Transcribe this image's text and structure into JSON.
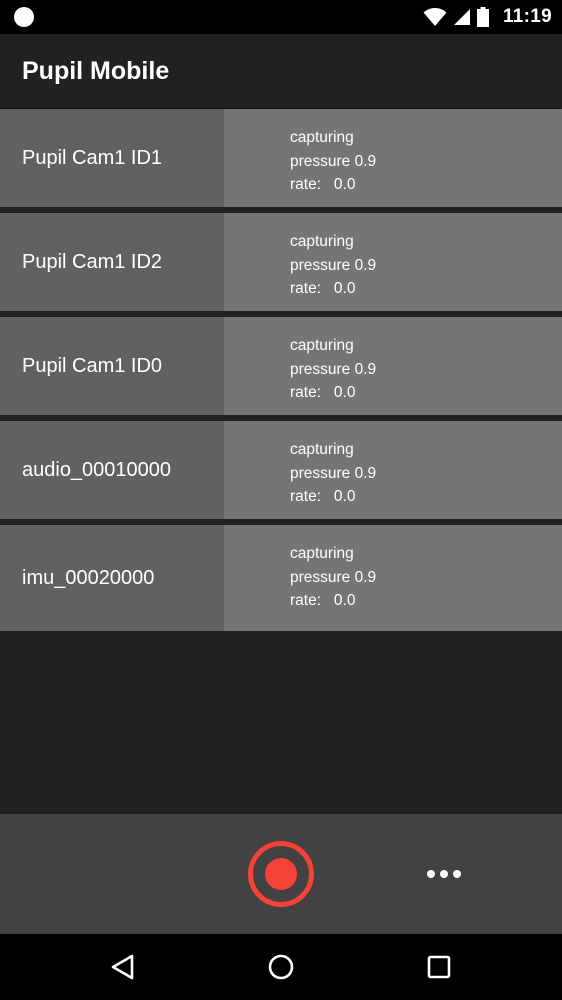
{
  "status_bar": {
    "time": "11:19",
    "icons": [
      "notification-dot",
      "wifi-icon",
      "cellular-signal-icon",
      "battery-icon"
    ]
  },
  "app_bar": {
    "title": "Pupil Mobile"
  },
  "sensors": [
    {
      "name": "Pupil Cam1 ID1",
      "status": "capturing",
      "pressure": "pressure 0.9",
      "rate": "rate:   0.0"
    },
    {
      "name": "Pupil Cam1 ID2",
      "status": "capturing",
      "pressure": "pressure 0.9",
      "rate": "rate:   0.0"
    },
    {
      "name": "Pupil Cam1 ID0",
      "status": "capturing",
      "pressure": "pressure 0.9",
      "rate": "rate:   0.0"
    },
    {
      "name": "audio_00010000",
      "status": "capturing",
      "pressure": "pressure 0.9",
      "rate": "rate:   0.0"
    },
    {
      "name": "imu_00020000",
      "status": "capturing",
      "pressure": "pressure 0.9",
      "rate": "rate:   0.0"
    }
  ],
  "bottom_bar": {
    "record_icon": "record-icon",
    "more_icon": "more-horizontal-icon",
    "record_color": "#f44336"
  },
  "nav_bar": {
    "icons": [
      "back-icon",
      "home-icon",
      "recents-icon"
    ]
  }
}
